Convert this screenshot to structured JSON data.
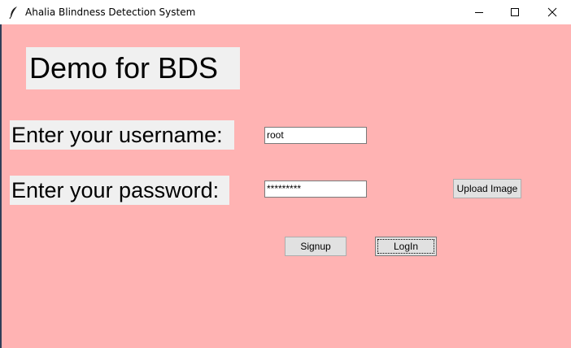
{
  "window": {
    "title": "Ahalia Blindness Detection System",
    "icon": "feather-icon",
    "controls": {
      "minimize": "minimize-icon",
      "maximize": "maximize-icon",
      "close": "close-icon"
    }
  },
  "form": {
    "heading": "Demo for BDS",
    "username_label": "Enter your username:",
    "username_value": "root",
    "password_label": "Enter your password:",
    "password_value": "*********",
    "upload_label": "Upload Image",
    "signup_label": "Signup",
    "login_label": "LogIn"
  },
  "colors": {
    "background": "#ffb3b3",
    "label_background": "#f0f0f0",
    "button_face": "#e1e1e1"
  }
}
